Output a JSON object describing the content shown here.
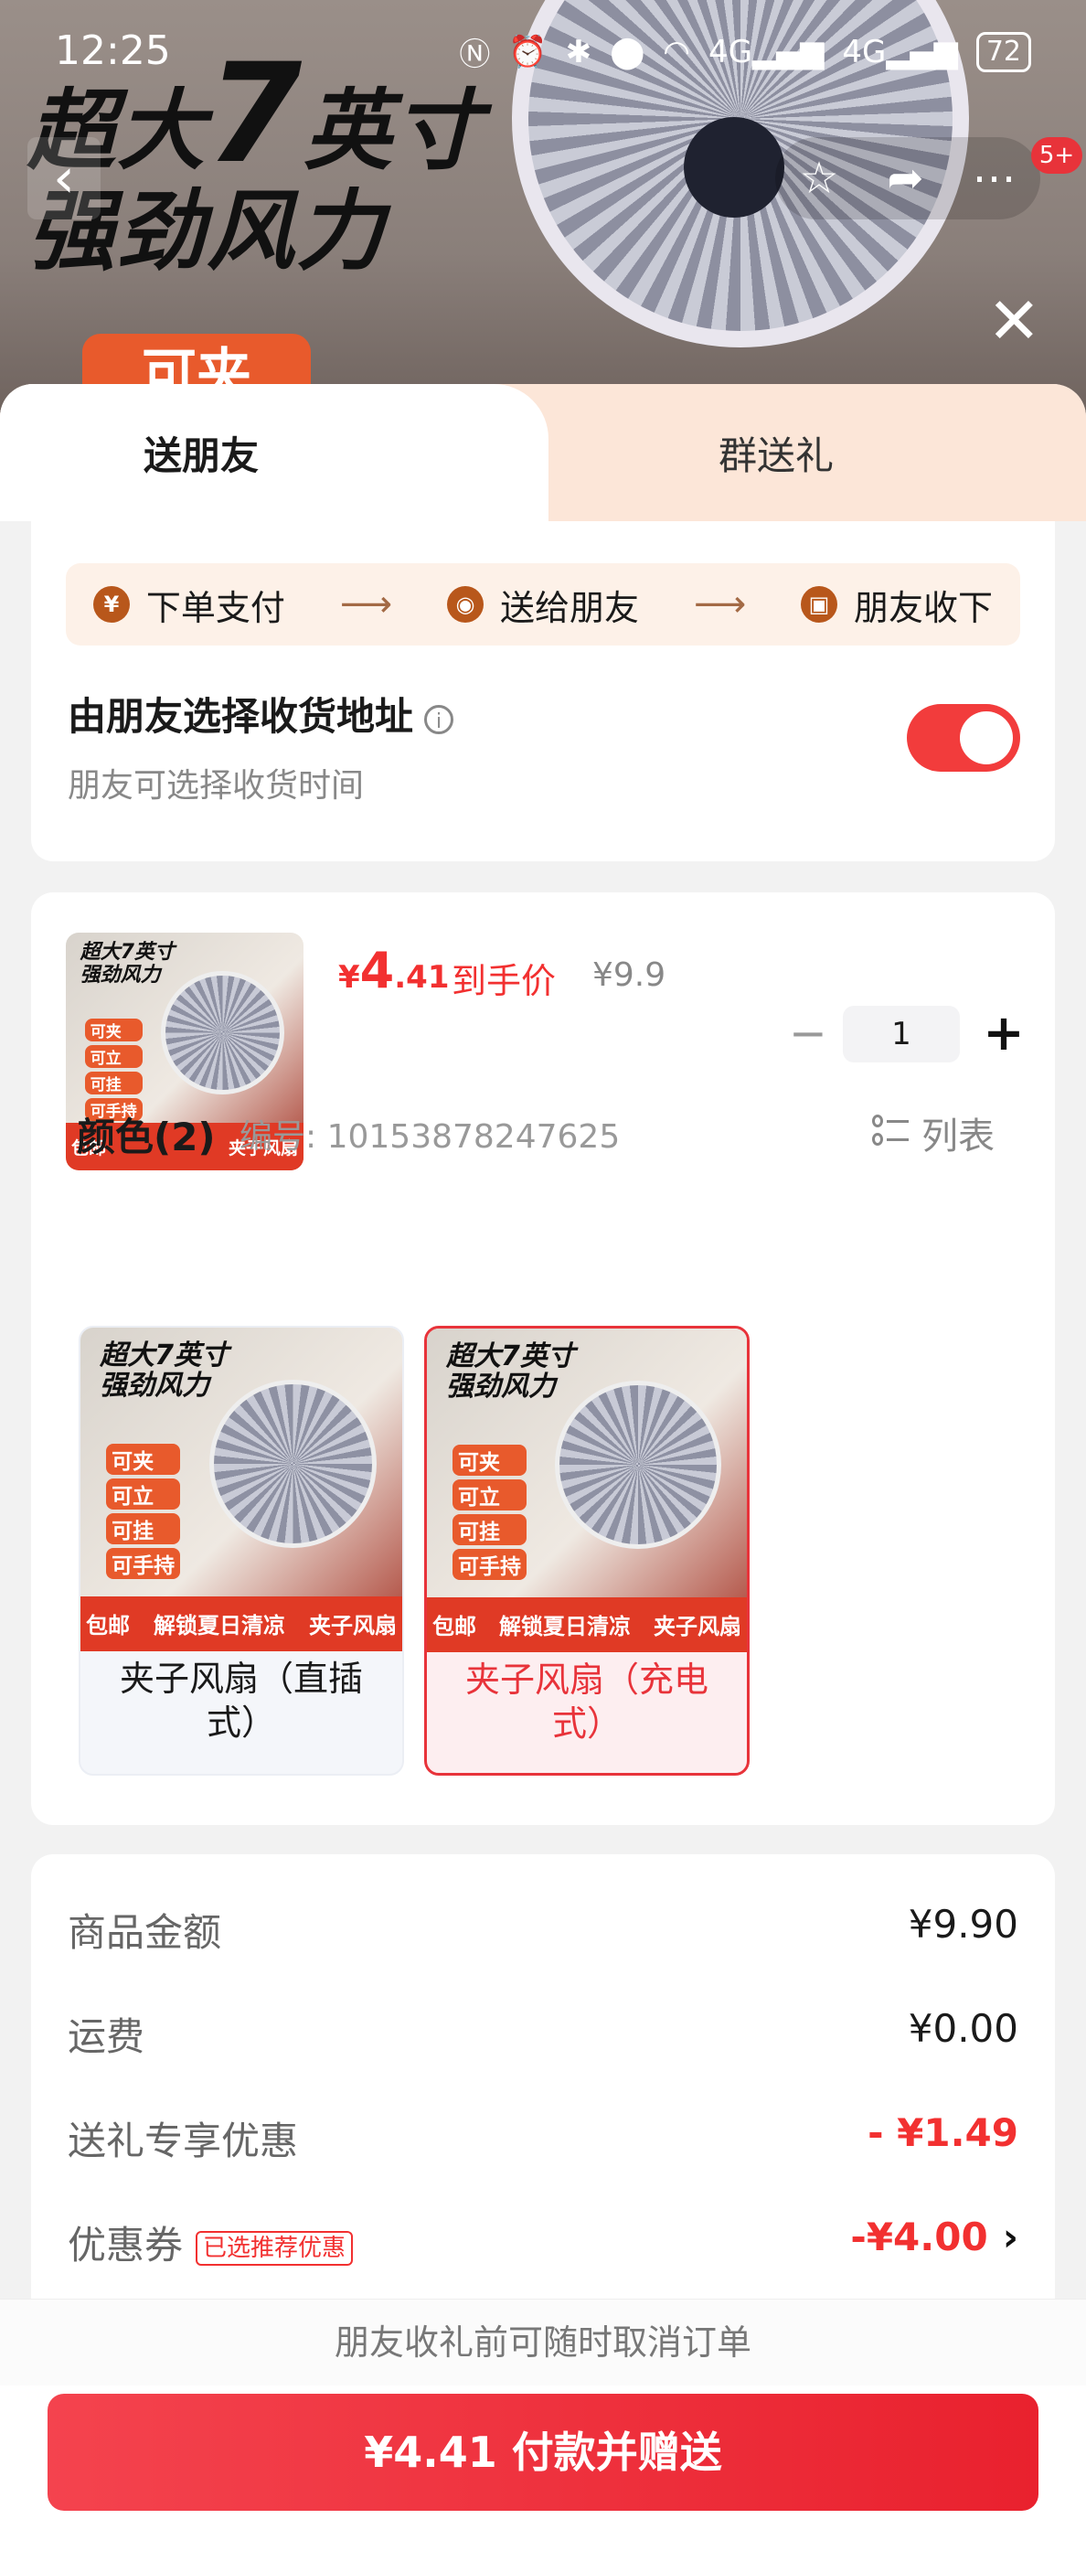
{
  "status_bar": {
    "time": "12:25",
    "battery": "72",
    "signal1": "4G",
    "signal2": "4G"
  },
  "hero": {
    "headline_line1_a": "超大",
    "headline_big": "7",
    "headline_line1_b": "英寸",
    "headline_line2": "强劲风力",
    "tag": "可夹",
    "badge": "5+"
  },
  "tabs": {
    "active": "送朋友",
    "inactive": "群送礼"
  },
  "steps": [
    {
      "label": "下单支付",
      "icon": "yuan-icon"
    },
    {
      "label": "送给朋友",
      "icon": "wechat-icon"
    },
    {
      "label": "朋友收下",
      "icon": "gift-icon"
    }
  ],
  "address": {
    "title": "由朋友选择收货地址",
    "subtitle": "朋友可选择收货时间",
    "toggle_on": true
  },
  "product": {
    "price_symbol": "¥",
    "price_int": "4",
    "price_dec": ".41",
    "price_label": "到手价",
    "original_price": "¥9.9",
    "quantity": "1",
    "thumb": {
      "line1": "超大7英寸",
      "line2": "强劲风力",
      "chips": [
        "可夹",
        "可立",
        "可挂",
        "可手持"
      ],
      "bar_left": "包邮",
      "bar_mid": "解锁夏日清凉",
      "bar_right": "夹子风扇"
    }
  },
  "color": {
    "title": "颜色(2)",
    "sku": "编号: 10153878247625",
    "list_label": "列表"
  },
  "options": [
    {
      "label": "夹子风扇（直插式）",
      "selected": false
    },
    {
      "label": "夹子风扇（充电式）",
      "selected": true
    }
  ],
  "summary": [
    {
      "label": "商品金额",
      "value": "¥9.90"
    },
    {
      "label": "运费",
      "value": "¥0.00"
    },
    {
      "label": "送礼专享优惠",
      "value": "- ¥1.49"
    },
    {
      "label": "优惠券",
      "tag": "已选推荐优惠",
      "value": "-¥4.00"
    }
  ],
  "footer": {
    "notice": "朋友收礼前可随时取消订单",
    "pay_button": "¥4.41 付款并赠送"
  },
  "colors": {
    "accent": "#f23030",
    "tab_bg": "#fce6d8",
    "step_bg": "#fdf1e8"
  }
}
